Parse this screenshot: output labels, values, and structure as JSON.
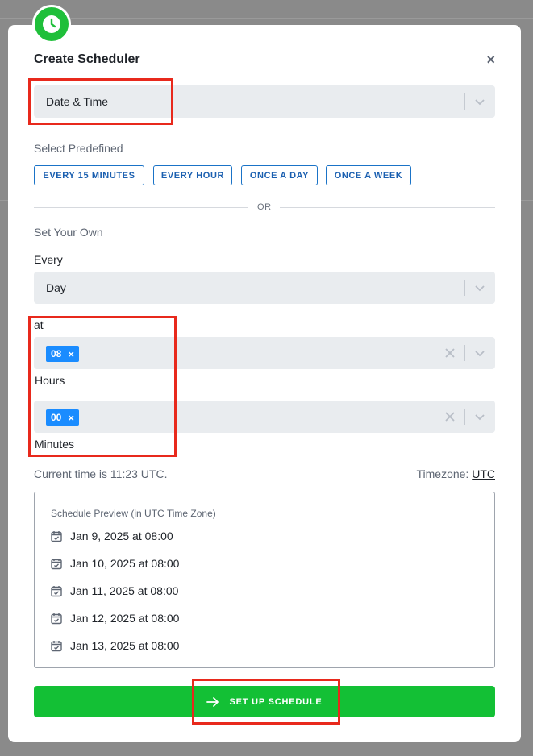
{
  "modal": {
    "title": "Create Scheduler",
    "close_label": "×"
  },
  "trigger_select": {
    "value": "Date & Time"
  },
  "predefined": {
    "label": "Select Predefined",
    "options": [
      "EVERY 15 MINUTES",
      "EVERY HOUR",
      "ONCE A DAY",
      "ONCE A WEEK"
    ]
  },
  "divider": {
    "text": "OR"
  },
  "custom": {
    "label": "Set Your Own",
    "every_label": "Every",
    "every_value": "Day",
    "at_label": "at",
    "hours_tag": "08",
    "hours_label": "Hours",
    "minutes_tag": "00",
    "minutes_label": "Minutes",
    "tag_remove": "×"
  },
  "time_info": {
    "current": "Current time is 11:23 UTC.",
    "timezone_label": "Timezone:",
    "timezone_value": "UTC"
  },
  "preview": {
    "title": "Schedule Preview (in UTC Time Zone)",
    "items": [
      "Jan 9, 2025 at 08:00",
      "Jan 10, 2025 at 08:00",
      "Jan 11, 2025 at 08:00",
      "Jan 12, 2025 at 08:00",
      "Jan 13, 2025 at 08:00"
    ]
  },
  "cta": {
    "label": "SET UP SCHEDULE"
  },
  "colors": {
    "primary_green": "#13c035",
    "tag_blue": "#1a8cff",
    "highlight_red": "#e8291c"
  }
}
